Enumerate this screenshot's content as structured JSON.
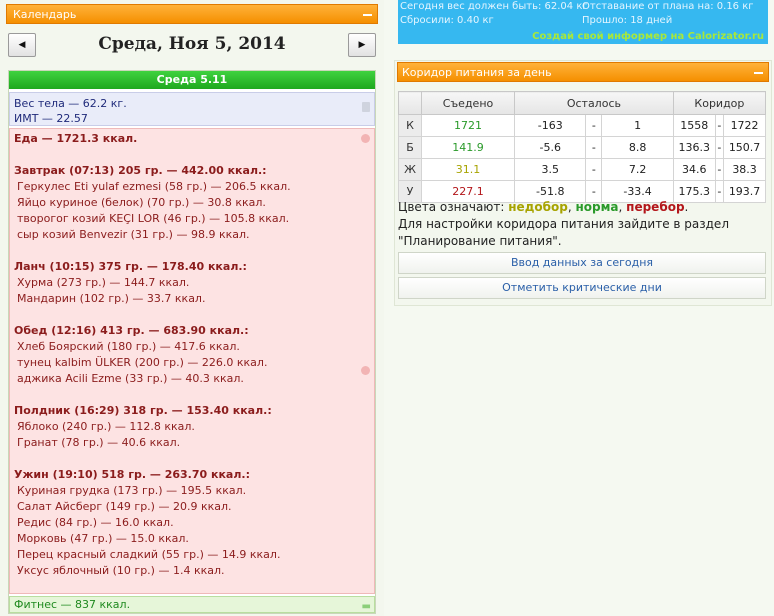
{
  "calendar": {
    "header_title": "Календарь",
    "prev_label": "◀",
    "next_label": "▶",
    "date_title": "Среда, Ноя 5, 2014"
  },
  "day": {
    "header": "Среда 5.11",
    "weight_line": "Вес тела — 62.2 кг.",
    "bmi_line": "ИМТ — 22.57",
    "food_total": "Еда — 1721.3 ккал.",
    "meals": [
      {
        "title": "Завтрак (07:13) 205 гр. — 442.00 ккал.:",
        "items": [
          "Геркулес Eti yulaf ezmesi (58 гр.) — 206.5 ккал.",
          "Яйцо куриное (белок) (70 гр.) — 30.8 ккал.",
          "творогог козий KEÇI LOR (46 гр.) — 105.8 ккал.",
          "сыр козий Benvezir (31 гр.) — 98.9 ккал."
        ]
      },
      {
        "title": "Ланч (10:15) 375 гр. — 178.40 ккал.:",
        "items": [
          "Хурма (273 гр.) — 144.7 ккал.",
          "Мандарин (102 гр.) — 33.7 ккал."
        ]
      },
      {
        "title": "Обед (12:16) 413 гр. — 683.90 ккал.:",
        "items": [
          "Хлеб Боярский (180 гр.) — 417.6 ккал.",
          "тунец kalbim ÜLKER (200 гр.) — 226.0 ккал.",
          "аджика Acili Ezme (33 гр.) — 40.3 ккал."
        ]
      },
      {
        "title": "Полдник (16:29) 318 гр. — 153.40 ккал.:",
        "items": [
          "Яблоко (240 гр.) — 112.8 ккал.",
          "Гранат (78 гр.) — 40.6 ккал."
        ]
      },
      {
        "title": "Ужин (19:10) 518 гр. — 263.70 ккал.:",
        "items": [
          "Куриная грудка (173 гр.) — 195.5 ккал.",
          "Салат Айсберг (149 гр.) — 20.9 ккал.",
          "Редис (84 гр.) — 16.0 ккал.",
          "Морковь (47 гр.) — 15.0 ккал.",
          "Перец красный сладкий (55 гр.) — 14.9 ккал.",
          "Уксус яблочный (10 гр.) — 1.4 ккал."
        ]
      }
    ],
    "fitness": "Фитнес — 837 ккал."
  },
  "informer": {
    "line1_left": "Сегодня вес должен быть: 62.04 кг",
    "line1_right": "Отставание от плана на: 0.16 кг",
    "line2_left": "Сбросили: 0.40 кг",
    "line2_right": "Прошло: 18 дней",
    "link": "Создай свой информер на Calorizator.ru"
  },
  "corridor": {
    "header_title": "Коридор питания за день",
    "columns": [
      "Съедено",
      "Осталось",
      "Коридор"
    ],
    "rows": [
      {
        "label": "К",
        "eaten": "1721",
        "eaten_color": "#2a9a2a",
        "rem_from": "-163",
        "rem_to": "1",
        "cor_from": "1558",
        "cor_to": "1722"
      },
      {
        "label": "Б",
        "eaten": "141.9",
        "eaten_color": "#2a9a2a",
        "rem_from": "-5.6",
        "rem_to": "8.8",
        "cor_from": "136.3",
        "cor_to": "150.7"
      },
      {
        "label": "Ж",
        "eaten": "31.1",
        "eaten_color": "#a7a300",
        "rem_from": "3.5",
        "rem_to": "7.2",
        "cor_from": "34.6",
        "cor_to": "38.3"
      },
      {
        "label": "У",
        "eaten": "227.1",
        "eaten_color": "#b3161a",
        "rem_from": "-51.8",
        "rem_to": "-33.4",
        "cor_from": "175.3",
        "cor_to": "193.7"
      }
    ],
    "dash": "-",
    "legend_prefix": "Цвета означают:",
    "legend_under": "недобор",
    "legend_norm": "норма",
    "legend_over": "перебор",
    "note_line1": "Для настройки коридора питания зайдите в раздел",
    "note_line2": "\"Планирование питания\".",
    "btn_input": "Ввод данных за сегодня",
    "btn_critical": "Отметить критические дни"
  }
}
